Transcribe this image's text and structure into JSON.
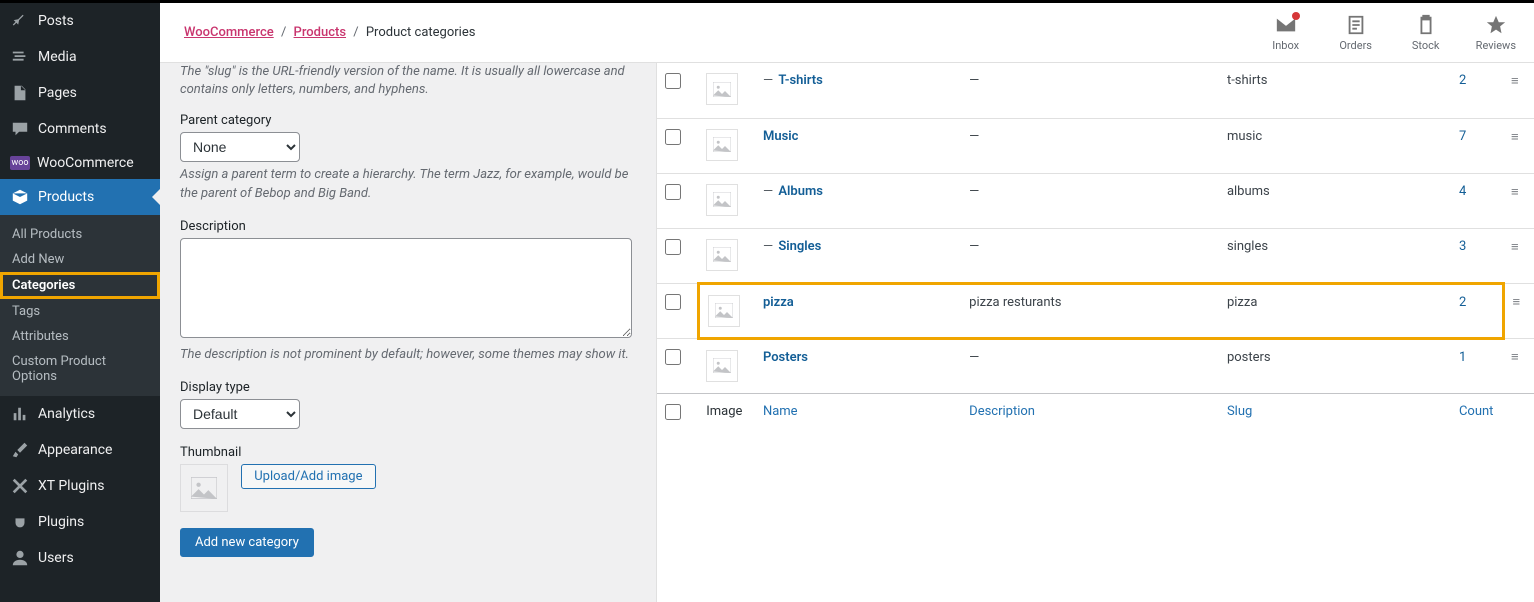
{
  "sidebar": {
    "items": [
      {
        "label": "Posts",
        "icon": "pin"
      },
      {
        "label": "Media",
        "icon": "media"
      },
      {
        "label": "Pages",
        "icon": "page"
      },
      {
        "label": "Comments",
        "icon": "comment"
      },
      {
        "label": "WooCommerce",
        "icon": "woo"
      },
      {
        "label": "Products",
        "icon": "products",
        "active": true
      },
      {
        "label": "Analytics",
        "icon": "chart"
      },
      {
        "label": "Appearance",
        "icon": "brush"
      },
      {
        "label": "XT Plugins",
        "icon": "xt"
      },
      {
        "label": "Plugins",
        "icon": "plug"
      },
      {
        "label": "Users",
        "icon": "user"
      }
    ],
    "submenu": [
      {
        "label": "All Products"
      },
      {
        "label": "Add New"
      },
      {
        "label": "Categories",
        "highlight": true
      },
      {
        "label": "Tags"
      },
      {
        "label": "Attributes"
      },
      {
        "label": "Custom Product Options"
      }
    ]
  },
  "breadcrumb": {
    "items": [
      {
        "label": "WooCommerce",
        "link": true
      },
      {
        "label": "Products",
        "link": true
      },
      {
        "label": "Product categories",
        "link": false
      }
    ],
    "sep": "/"
  },
  "activity": [
    {
      "label": "Inbox",
      "icon": "mail",
      "dot": true
    },
    {
      "label": "Orders",
      "icon": "order"
    },
    {
      "label": "Stock",
      "icon": "clipboard"
    },
    {
      "label": "Reviews",
      "icon": "star"
    }
  ],
  "form": {
    "slug_help": "The \"slug\" is the URL-friendly version of the name. It is usually all lowercase and contains only letters, numbers, and hyphens.",
    "parent_label": "Parent category",
    "parent_value": "None",
    "parent_help": "Assign a parent term to create a hierarchy. The term Jazz, for example, would be the parent of Bebop and Big Band.",
    "desc_label": "Description",
    "desc_value": "",
    "desc_help": "The description is not prominent by default; however, some themes may show it.",
    "display_label": "Display type",
    "display_value": "Default",
    "thumb_label": "Thumbnail",
    "upload_btn": "Upload/Add image",
    "submit_btn": "Add new category"
  },
  "table": {
    "headers": {
      "image": "Image",
      "name": "Name",
      "desc": "Description",
      "slug": "Slug",
      "count": "Count"
    },
    "rows": [
      {
        "indent": "—",
        "name": "T-shirts",
        "desc": "—",
        "slug": "t-shirts",
        "count": "2"
      },
      {
        "indent": "",
        "name": "Music",
        "desc": "—",
        "slug": "music",
        "count": "7"
      },
      {
        "indent": "—",
        "name": "Albums",
        "desc": "—",
        "slug": "albums",
        "count": "4"
      },
      {
        "indent": "—",
        "name": "Singles",
        "desc": "—",
        "slug": "singles",
        "count": "3"
      },
      {
        "indent": "",
        "name": "pizza",
        "desc": "pizza resturants",
        "slug": "pizza",
        "count": "2",
        "highlight": true
      },
      {
        "indent": "",
        "name": "Posters",
        "desc": "—",
        "slug": "posters",
        "count": "1"
      }
    ]
  }
}
